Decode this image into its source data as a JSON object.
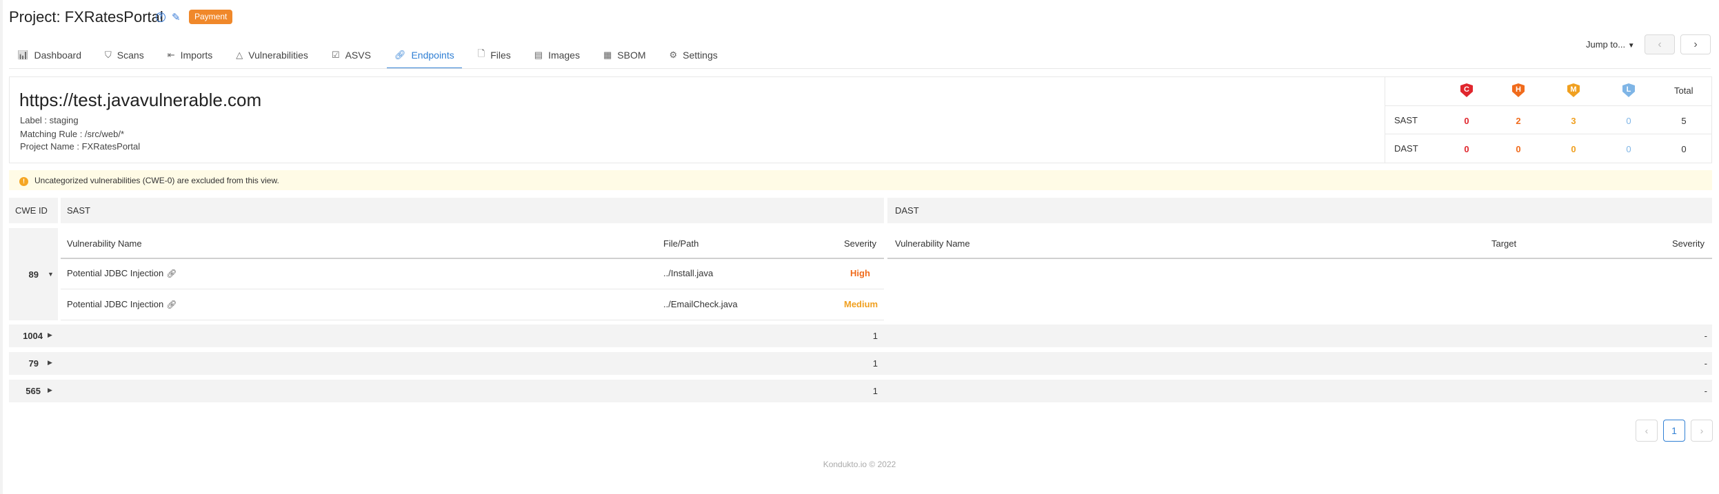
{
  "header": {
    "project_title": "Project: FXRatesPortal",
    "badge": "Payment"
  },
  "tabs": [
    {
      "label": "Dashboard",
      "icon": "chart-icon"
    },
    {
      "label": "Scans",
      "icon": "shield-icon"
    },
    {
      "label": "Imports",
      "icon": "import-icon"
    },
    {
      "label": "Vulnerabilities",
      "icon": "warning-icon"
    },
    {
      "label": "ASVS",
      "icon": "checklist-icon"
    },
    {
      "label": "Endpoints",
      "icon": "link-icon",
      "active": true
    },
    {
      "label": "Files",
      "icon": "file-icon"
    },
    {
      "label": "Images",
      "icon": "image-icon"
    },
    {
      "label": "SBOM",
      "icon": "sbom-icon"
    },
    {
      "label": "Settings",
      "icon": "gear-icon"
    }
  ],
  "toolbar": {
    "jump_label": "Jump to...",
    "prev": "‹",
    "next": "›"
  },
  "endpoint": {
    "url": "https://test.javavulnerable.com",
    "label": "Label : staging",
    "matching_rule": "Matching Rule : /src/web/*",
    "project_name": "Project Name : FXRatesPortal"
  },
  "summary": {
    "severity_headers": [
      {
        "letter": "C",
        "color": "#e0262d"
      },
      {
        "letter": "H",
        "color": "#f06b1c"
      },
      {
        "letter": "M",
        "color": "#f0a020"
      },
      {
        "letter": "L",
        "color": "#7fb5e6"
      }
    ],
    "total_label": "Total",
    "rows": [
      {
        "label": "SAST",
        "c": "0",
        "h": "2",
        "m": "3",
        "l": "0",
        "total": "5"
      },
      {
        "label": "DAST",
        "c": "0",
        "h": "0",
        "m": "0",
        "l": "0",
        "total": "0"
      }
    ]
  },
  "notice": {
    "text": "Uncategorized vulnerabilities (CWE-0) are excluded from this view."
  },
  "table": {
    "cwe_header": "CWE ID",
    "sast_header": "SAST",
    "dast_header": "DAST",
    "sast_columns": [
      "Vulnerability Name",
      "File/Path",
      "Severity"
    ],
    "dast_columns": [
      "Vulnerability Name",
      "Target",
      "Severity"
    ],
    "expanded": {
      "cwe": "89",
      "rows": [
        {
          "name": "Potential JDBC Injection",
          "path": "../Install.java",
          "severity": "High"
        },
        {
          "name": "Potential JDBC Injection",
          "path": "../EmailCheck.java",
          "severity": "Medium"
        }
      ]
    },
    "collapsed": [
      {
        "cwe": "1004",
        "sast_count": "1",
        "dast_count": "-"
      },
      {
        "cwe": "79",
        "sast_count": "1",
        "dast_count": "-"
      },
      {
        "cwe": "565",
        "sast_count": "1",
        "dast_count": "-"
      }
    ]
  },
  "pagination": {
    "prev": "‹",
    "current": "1",
    "next": "›"
  },
  "footer": "Kondukto.io © 2022"
}
